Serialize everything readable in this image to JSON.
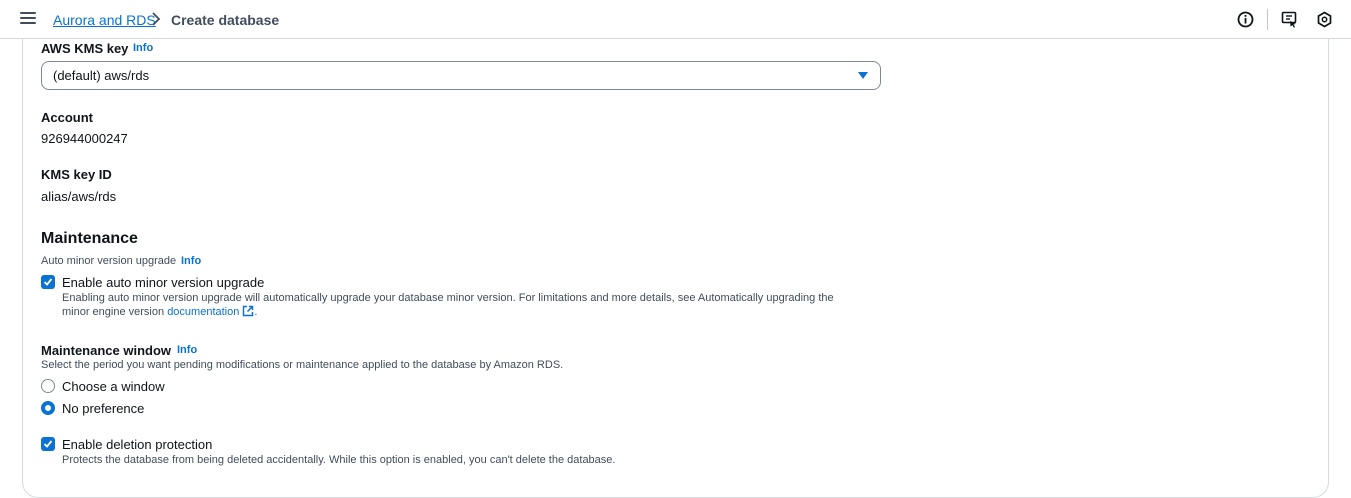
{
  "header": {
    "breadcrumb_parent": "Aurora and RDS",
    "breadcrumb_current": "Create database"
  },
  "kms": {
    "label": "AWS KMS key",
    "info": "Info",
    "selected": "(default) aws/rds",
    "account_label": "Account",
    "account_value": "926944000247",
    "key_id_label": "KMS key ID",
    "key_id_value": "alias/aws/rds"
  },
  "maintenance": {
    "title": "Maintenance",
    "auto_label": "Auto minor version upgrade",
    "auto_info": "Info",
    "auto_checkbox_label": "Enable auto minor version upgrade",
    "auto_desc_line1": "Enabling auto minor version upgrade will automatically upgrade your database minor version. For limitations and more details, see Automatically upgrading the",
    "auto_desc_line2_prefix": "minor engine version",
    "auto_desc_link": "documentation",
    "auto_desc_suffix": ".",
    "window_label": "Maintenance window",
    "window_info": "Info",
    "window_desc": "Select the period you want pending modifications or maintenance applied to the database by Amazon RDS.",
    "option_choose": "Choose a window",
    "option_no_pref": "No preference",
    "deletion_label": "Enable deletion protection",
    "deletion_desc": "Protects the database from being deleted accidentally. While this option is enabled, you can't delete the database."
  },
  "colors": {
    "accent": "#0972d3",
    "text": "#0f141a",
    "secondary": "#414d5c"
  }
}
